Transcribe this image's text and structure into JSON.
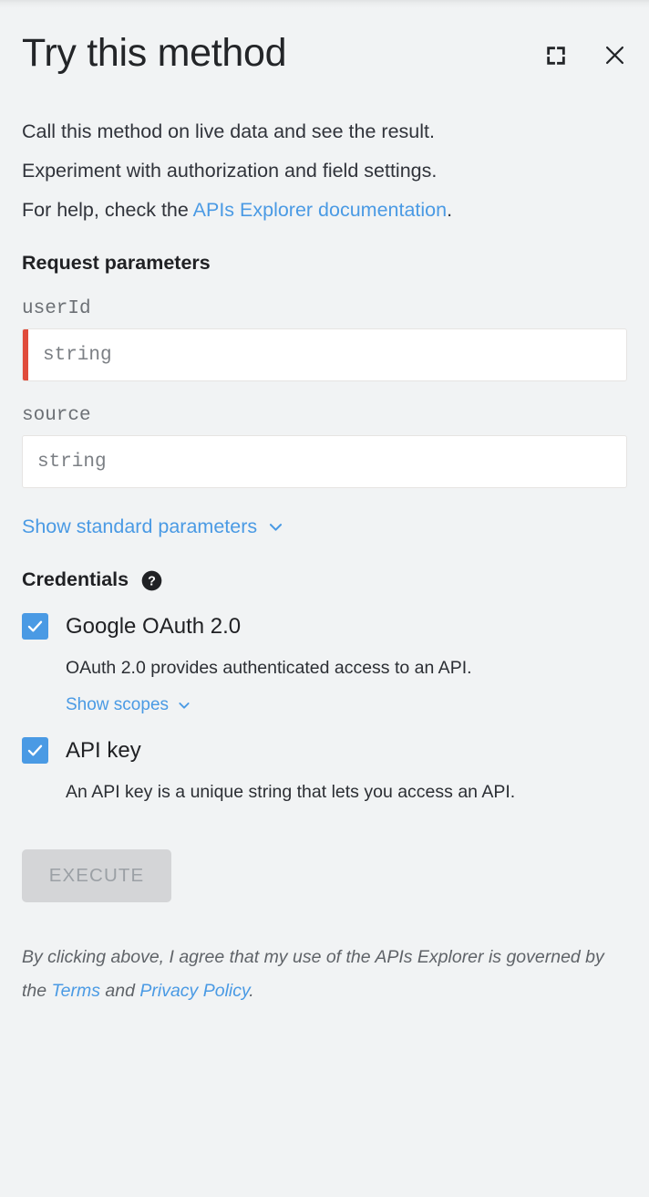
{
  "header": {
    "title": "Try this method",
    "fullscreen_icon": "fullscreen-expand-icon",
    "close_icon": "close-icon"
  },
  "description": {
    "line1": "Call this method on live data and see the result.",
    "line2": "Experiment with authorization and field settings.",
    "line3_prefix": "For help, check the ",
    "link_text": "APIs Explorer documentation",
    "line3_suffix": "."
  },
  "request_parameters": {
    "heading": "Request parameters",
    "fields": [
      {
        "name": "userId",
        "placeholder": "string",
        "value": "",
        "required": true
      },
      {
        "name": "source",
        "placeholder": "string",
        "value": "",
        "required": false
      }
    ],
    "show_standard_label": "Show standard parameters",
    "show_standard_chevron": "chevron-down-icon"
  },
  "credentials": {
    "heading": "Credentials",
    "help_icon": "help-question-icon",
    "items": [
      {
        "label": "Google OAuth 2.0",
        "checked": true,
        "description": "OAuth 2.0 provides authenticated access to an API.",
        "sub_link": "Show scopes",
        "sub_link_chevron": "chevron-down-icon"
      },
      {
        "label": "API key",
        "checked": true,
        "description": "An API key is a unique string that lets you access an API.",
        "sub_link": null,
        "sub_link_chevron": null
      }
    ]
  },
  "execute": {
    "label": "EXECUTE",
    "disabled": true
  },
  "footer": {
    "prefix": "By clicking above, I agree that my use of the APIs Explorer is governed by the ",
    "terms_link": "Terms",
    "middle": " and ",
    "privacy_link": "Privacy Policy",
    "suffix": "."
  },
  "colors": {
    "background": "#f1f3f4",
    "accent_blue": "#4a9ae4",
    "required_red": "#e04b3b",
    "text_primary": "#202124",
    "text_secondary": "#5f6368",
    "input_background": "#ffffff",
    "button_disabled_bg": "#d4d5d7",
    "button_disabled_text": "#9ba0a5"
  }
}
